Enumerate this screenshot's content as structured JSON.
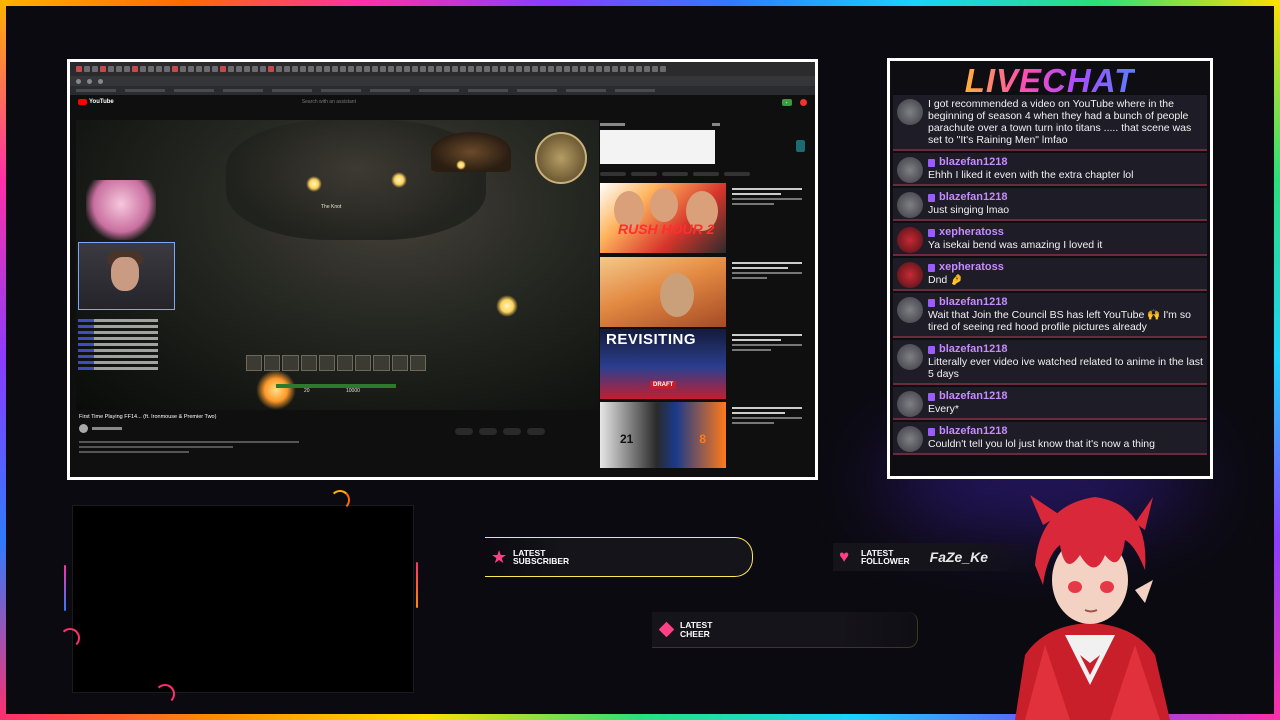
{
  "browser": {
    "youtube_logo": "YouTube",
    "search_placeholder": "Search with an assistant",
    "video_title": "First Time Playing FF14... (ft. Ironmouse & Premier Two)",
    "thumb_labels": {
      "rush_hour": "RUSH HOUR 2",
      "revisiting": "REVISITING",
      "draft": "DRAFT",
      "jersey_left": "21",
      "jersey_right": "8"
    },
    "game_hud": {
      "location": "The Knot",
      "hp_value": "10000",
      "level": "20"
    }
  },
  "chat": {
    "title": "LIVECHAT",
    "messages": [
      {
        "user": "",
        "text": "I got recommended a video on YouTube where in the beginning of season 4 when they had a bunch of people parachute over a town turn into titans ..... that scene was set to \"It's Raining Men\" lmfao",
        "avatar": "gray"
      },
      {
        "user": "blazefan1218",
        "text": "Ehhh I liked it even with the extra chapter lol",
        "avatar": "gray"
      },
      {
        "user": "blazefan1218",
        "text": "Just singing lmao",
        "avatar": "gray"
      },
      {
        "user": "xepheratoss",
        "text": "Ya isekai bend was amazing I loved it",
        "avatar": "red"
      },
      {
        "user": "xepheratoss",
        "text": "Dnd 🤌",
        "avatar": "red"
      },
      {
        "user": "blazefan1218",
        "text": "Wait that Join the Council BS has left YouTube 🙌 I'm so tired of seeing red hood profile pictures already",
        "avatar": "gray"
      },
      {
        "user": "blazefan1218",
        "text": "Litterally ever video ive watched related to anime in the last 5 days",
        "avatar": "gray"
      },
      {
        "user": "blazefan1218",
        "text": "Every*",
        "avatar": "gray"
      },
      {
        "user": "blazefan1218",
        "text": "Couldn't tell you lol just know that it's now a thing",
        "avatar": "gray"
      }
    ]
  },
  "widgets": {
    "subscriber": {
      "label_1": "LATEST",
      "label_2": "SUBSCRIBER",
      "value": ""
    },
    "follower": {
      "label_1": "LATEST",
      "label_2": "FOLLOWER",
      "value": "FaZe_Ke"
    },
    "cheer": {
      "label_1": "LATEST",
      "label_2": "CHEER",
      "value": ""
    }
  },
  "colors": {
    "accent_pink": "#ff3f86",
    "username_purple": "#c58bff",
    "subscriber_border": "#ffe85a"
  },
  "icons": {
    "subscriber": "star-icon",
    "follower": "heart-icon",
    "cheer": "diamond-icon"
  }
}
